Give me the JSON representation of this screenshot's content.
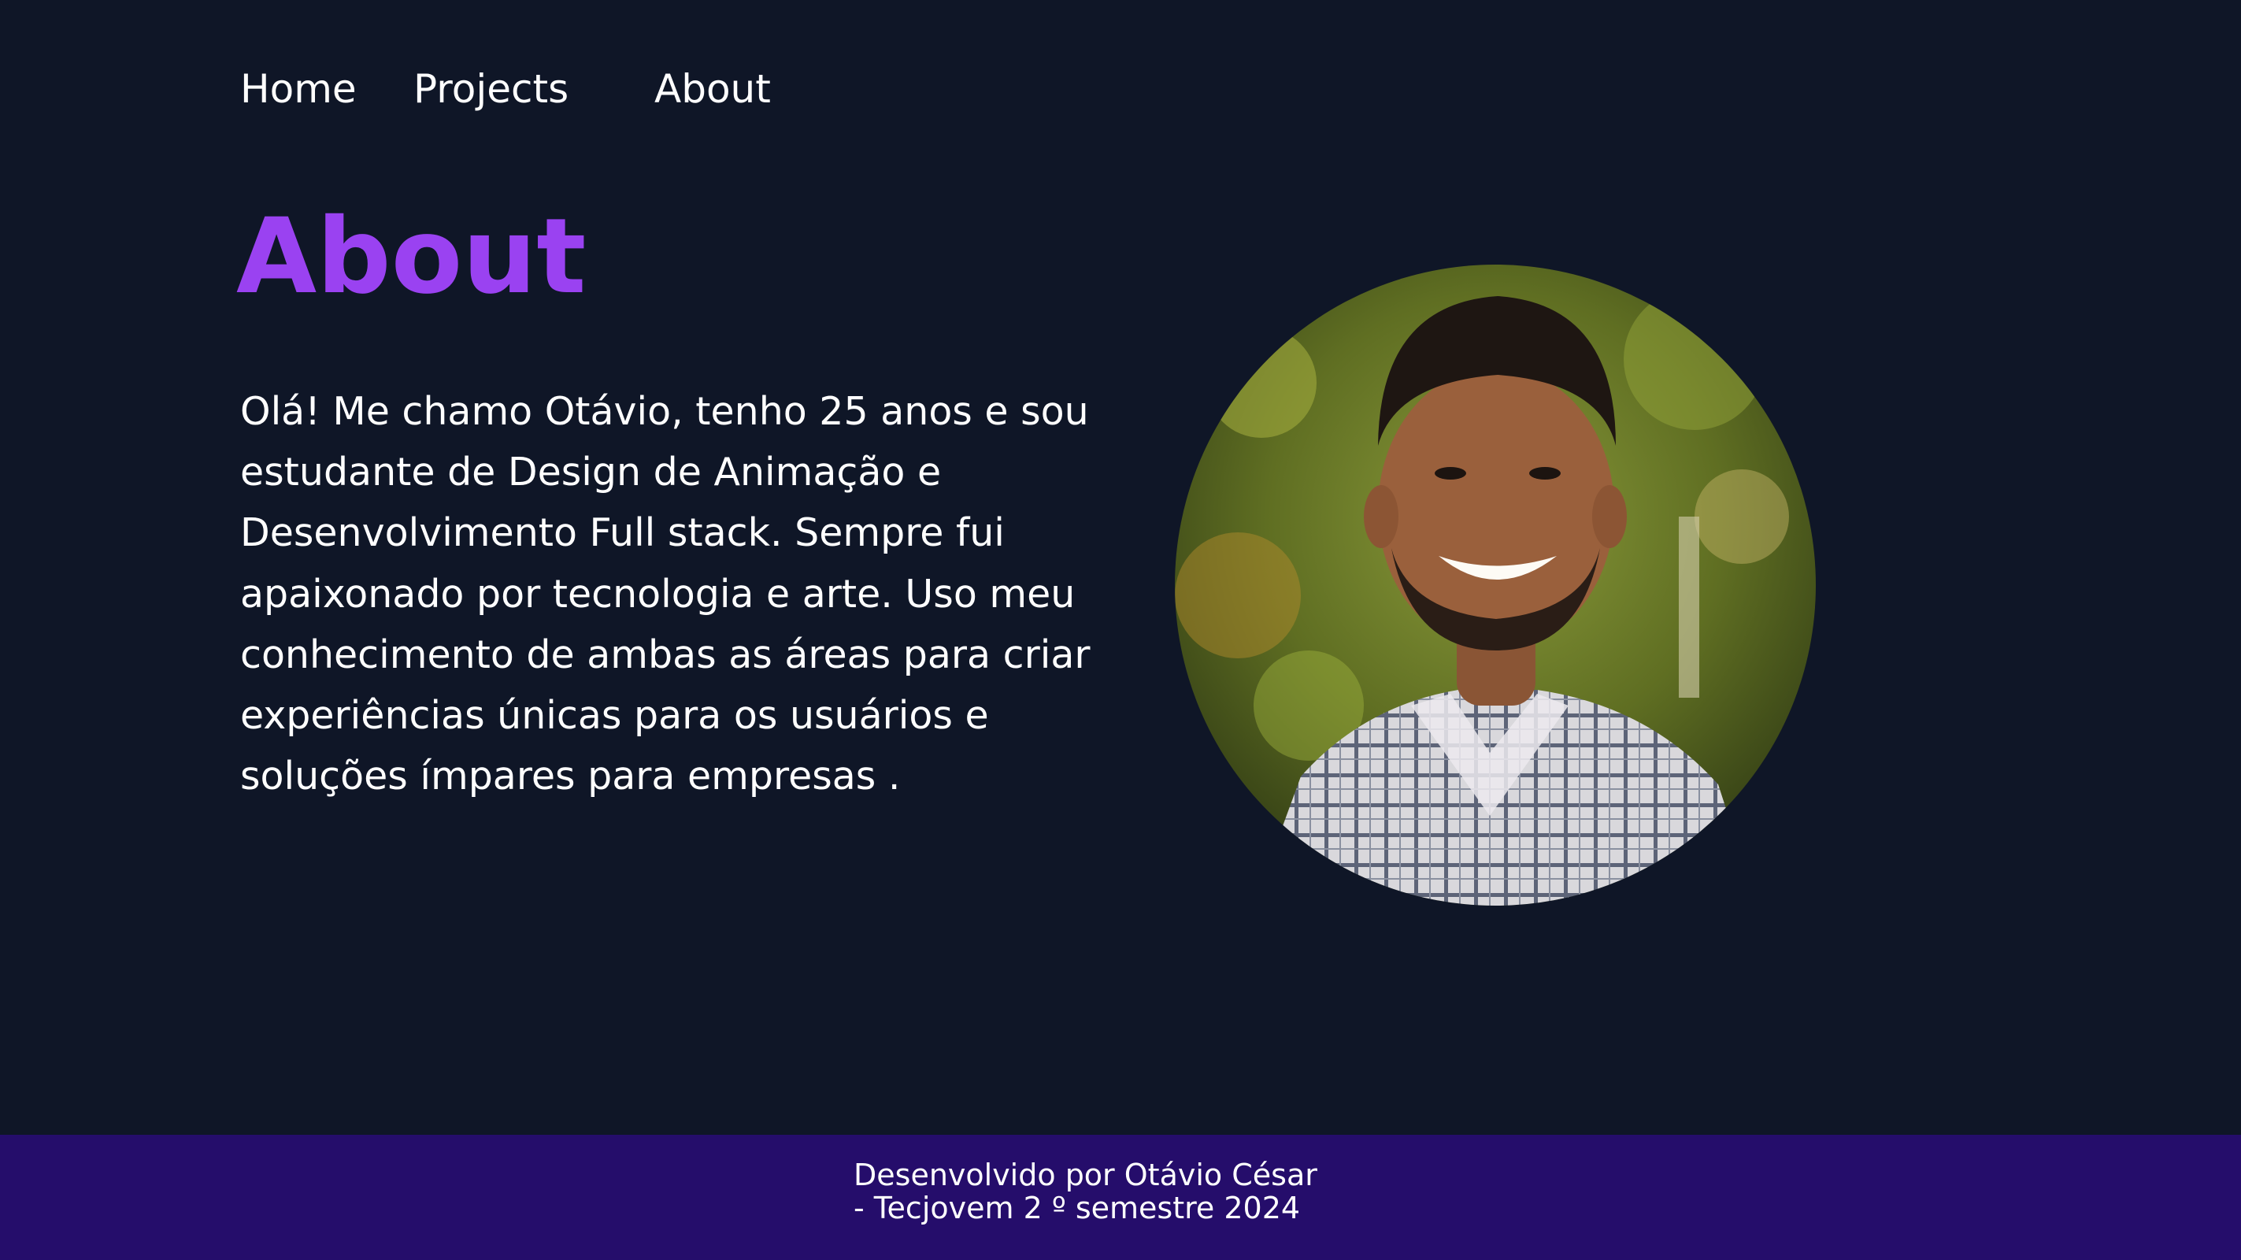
{
  "nav": {
    "home": "Home",
    "projects": "Projects",
    "about": "About"
  },
  "about": {
    "title": "About",
    "bio": "Olá! Me chamo Otávio, tenho 25 anos e sou estudante de Design de Animação e Desenvolvimento Full stack. Sempre fui apaixonado por tecnologia e arte. Uso meu conhecimento de ambas as áreas para criar experiências únicas para os usuários e soluções ímpares para empresas ."
  },
  "footer": {
    "line1": "Desenvolvido por Otávio César",
    "line2": "- Tecjovem 2 º semestre 2024"
  },
  "colors": {
    "background": "#0f1627",
    "accent": "#9a42f1",
    "footer_bg": "#250d6b"
  }
}
